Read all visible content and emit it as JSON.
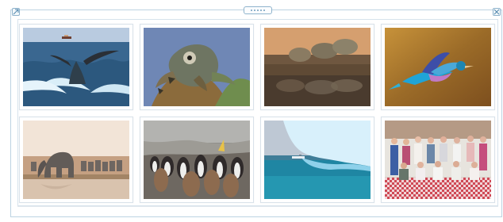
{
  "gallery": {
    "controls": {
      "left_icon": "expand-icon",
      "right_icon": "close-icon",
      "drag_icon": "drag-handle-icon"
    },
    "tiles": [
      {
        "name": "humpback-whale-image",
        "credit": ""
      },
      {
        "name": "chameleon-image",
        "credit": ""
      },
      {
        "name": "quail-family-image",
        "credit": ""
      },
      {
        "name": "lilac-breasted-roller-image",
        "credit": ""
      },
      {
        "name": "elephants-at-waterhole-image",
        "credit": ""
      },
      {
        "name": "penguin-colony-image",
        "credit": ""
      },
      {
        "name": "iceberg-and-ship-image",
        "credit": ""
      },
      {
        "name": "group-photo-image",
        "credit": ""
      }
    ]
  }
}
